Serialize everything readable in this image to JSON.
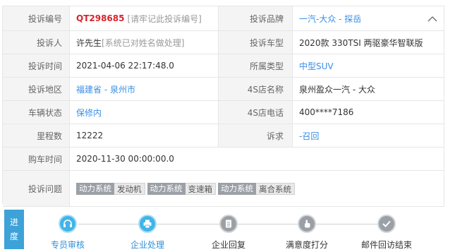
{
  "complaint": {
    "rows": [
      {
        "l1": "投诉编号",
        "v1": "QT298685",
        "v1_note": "[请牢记此投诉编号]",
        "l2": "投诉品牌",
        "v2": "一汽-大众 - 探岳"
      },
      {
        "l1": "投诉人",
        "v1": "许先生",
        "v1_note": "[系统已对姓名做处理]",
        "l2": "投诉车型",
        "v2": "2020款 330TSI 两驱豪华智联版"
      },
      {
        "l1": "投诉时间",
        "v1": "2021-04-06 22:17:48.0",
        "l2": "所属类型",
        "v2": "中型SUV"
      },
      {
        "l1": "投诉地区",
        "v1": "福建省 - 泉州市",
        "l2": "4S店名称",
        "v2": "泉州盈众一汽 - 大众"
      },
      {
        "l1": "车辆状态",
        "v1": "保修内",
        "l2": "4S店电话",
        "v2": "400****7186"
      },
      {
        "l1": "里程数",
        "v1": "12222",
        "l2": "诉求",
        "v2": "-召回"
      },
      {
        "l1": "购车时间",
        "v1": "2020-11-30 00:00:00.0"
      },
      {
        "l1": "投诉问题"
      }
    ],
    "issues": [
      {
        "category": "动力系统",
        "item": "发动机"
      },
      {
        "category": "动力系统",
        "item": "变速箱"
      },
      {
        "category": "动力系统",
        "item": "离合系统"
      }
    ]
  },
  "progress": {
    "label_top": "进",
    "label_bottom": "度",
    "steps": [
      {
        "label": "专员审核",
        "icon": "headset-icon",
        "status": "active"
      },
      {
        "label": "企业处理",
        "icon": "printer-icon",
        "status": "active"
      },
      {
        "label": "企业回复",
        "icon": "document-icon",
        "status": "done"
      },
      {
        "label": "满意度打分",
        "icon": "hand-pointer-icon",
        "status": "done"
      },
      {
        "label": "邮件回访结束",
        "icon": "check-mail-icon",
        "status": "done"
      }
    ]
  },
  "colors": {
    "accent": "#41b4e8",
    "link": "#3a8ee6",
    "id_red": "#d9232d",
    "done_gray": "#9aa0a6"
  }
}
